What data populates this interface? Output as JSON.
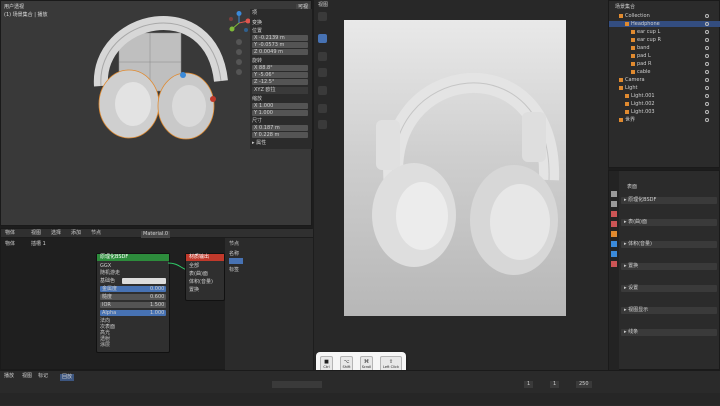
{
  "viewport": {
    "mode_label": "用户透视",
    "collection_label": "(1) 场景集合 | 播放",
    "vis_label": "可视"
  },
  "n_panel": {
    "tab": "项",
    "section_transform": "变换",
    "location_label": "位置",
    "location_values": [
      "X -0.2139 m",
      "Y -0.0573 m",
      "Z 0.0049 m"
    ],
    "rotation_label": "旋转",
    "rotation_values": [
      "X 88.8°",
      "Y -5.06°",
      "Z -12.5°"
    ],
    "mode_value": "XYZ 欧拉",
    "scale_label": "缩放",
    "scale_values": [
      "X 1.000",
      "Y 1.000",
      "Z 1.000"
    ],
    "dimensions_label": "尺寸",
    "dimensions_values": [
      "X 0.187 m",
      "Y 0.228 m",
      "Z 0.090 m"
    ],
    "properties_label": "▸ 属性"
  },
  "node_editor": {
    "header_items": [
      "物体",
      "视图",
      "选择",
      "添加",
      "节点"
    ],
    "material_name": "Material.0",
    "slot_label": "插槽 1",
    "object_label": "物体",
    "shader_node": {
      "title": "原理化BSDF",
      "subtitle": "GGX",
      "subtitle2": "随机游走",
      "rows": [
        "基础色",
        "金属度",
        "糙度",
        "IOR",
        "Alpha"
      ],
      "values": [
        "",
        "0.000",
        "0.600",
        "1.500",
        "1.000"
      ],
      "extra_rows": [
        "法向",
        "次表面",
        "高光",
        "透射",
        "涂层",
        "光泽",
        "自发光",
        "薄膜"
      ]
    },
    "output_node": {
      "title": "材质输出",
      "target": "全部",
      "rows": [
        "表(曲)面",
        "体积(音量)",
        "置换"
      ]
    },
    "side_panel": {
      "title": "节点",
      "rows": [
        "名称",
        "标签"
      ]
    }
  },
  "render_view": {
    "toolbar": [
      "↖",
      "✥",
      "⟳",
      "⤢",
      "✎",
      "📐",
      "⊞"
    ],
    "header_label": "视图"
  },
  "keycaps": [
    {
      "sym": "■",
      "label": "Ctrl"
    },
    {
      "sym": "⌥",
      "label": "Shift"
    },
    {
      "sym": "⌘",
      "label": "Scroll"
    },
    {
      "sym": "⇧",
      "label": "Left Click"
    }
  ],
  "outliner": {
    "title": "场景集合",
    "items": [
      {
        "label": "Collection",
        "indent": 1
      },
      {
        "label": "Headphone",
        "indent": 2,
        "selected": true
      },
      {
        "label": "ear cup L",
        "indent": 3
      },
      {
        "label": "ear cup R",
        "indent": 3
      },
      {
        "label": "band",
        "indent": 3
      },
      {
        "label": "pad L",
        "indent": 3
      },
      {
        "label": "pad R",
        "indent": 3
      },
      {
        "label": "cable",
        "indent": 3
      },
      {
        "label": "Camera",
        "indent": 1
      },
      {
        "label": "Light",
        "indent": 1
      },
      {
        "label": "Light.001",
        "indent": 2
      },
      {
        "label": "Light.002",
        "indent": 2
      },
      {
        "label": "Light.003",
        "indent": 2
      },
      {
        "label": "世界",
        "indent": 1
      }
    ]
  },
  "properties": {
    "tab_label": "表面",
    "sections": [
      "原理化BSDF",
      "表(曲)面",
      "体积(音量)",
      "置换",
      "设置",
      "视图显示",
      "线条"
    ],
    "preview_label": "预览"
  },
  "timeline": {
    "items": [
      "播放",
      "视图",
      "标记",
      "回放"
    ],
    "frame": "1",
    "start": "1",
    "end": "250"
  },
  "colors": {
    "accent": "#4772b3",
    "node_green": "#2d8c3c",
    "node_red": "#c0392b",
    "socket_yellow": "#c7c729",
    "socket_purple": "#6a5acd"
  }
}
